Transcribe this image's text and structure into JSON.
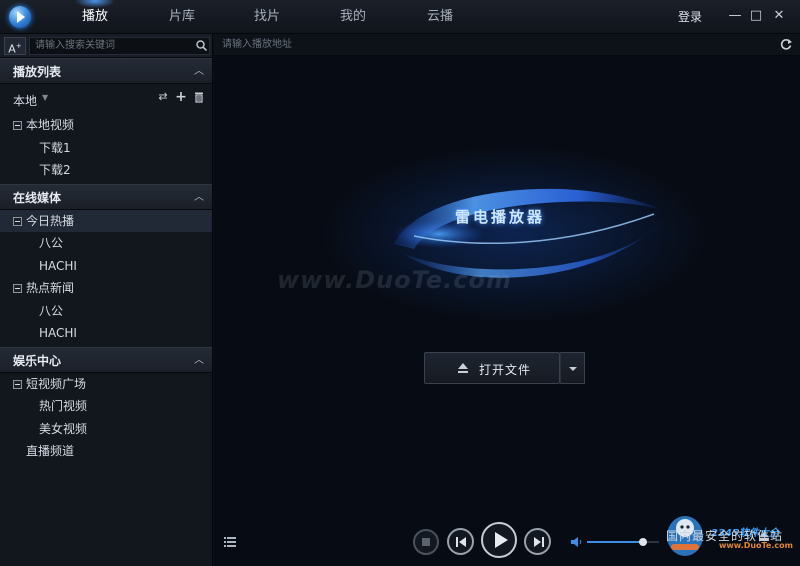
{
  "topbar": {
    "tabs": [
      {
        "label": "播放",
        "active": true
      },
      {
        "label": "片库",
        "active": false
      },
      {
        "label": "找片",
        "active": false
      },
      {
        "label": "我的",
        "active": false
      },
      {
        "label": "云播",
        "active": false
      }
    ],
    "login_label": "登录",
    "minimize_glyph": "—",
    "maximize_glyph": "□",
    "close_glyph": "✕"
  },
  "sidebar": {
    "font_button": "A",
    "search_placeholder": "请输入搜索关键词",
    "sections": [
      {
        "title": "播放列表",
        "local_label": "本地",
        "groups": [
          {
            "label": "本地视频",
            "children": [
              "下载1",
              "下载2"
            ]
          }
        ]
      },
      {
        "title": "在线媒体",
        "groups": [
          {
            "label": "今日热播",
            "children": [
              "八公",
              "HACHI"
            ]
          },
          {
            "label": "热点新闻",
            "children": [
              "八公",
              "HACHI"
            ]
          }
        ]
      },
      {
        "title": "娱乐中心",
        "groups": [
          {
            "label": "短视频广场",
            "children": [
              "热门视频",
              "美女视频"
            ]
          }
        ],
        "extra": "直播频道"
      }
    ]
  },
  "main": {
    "address_placeholder": "请输入播放地址",
    "brand_title": "雷电播放器",
    "watermark": "www.DuoTe.com",
    "open_file_label": "打开文件",
    "volume_level": 0.78,
    "site_slogan": "国内最安全的软件站"
  },
  "colors": {
    "accent": "#3b8de6",
    "background": "#070b13",
    "sidebar": "#12161d"
  }
}
